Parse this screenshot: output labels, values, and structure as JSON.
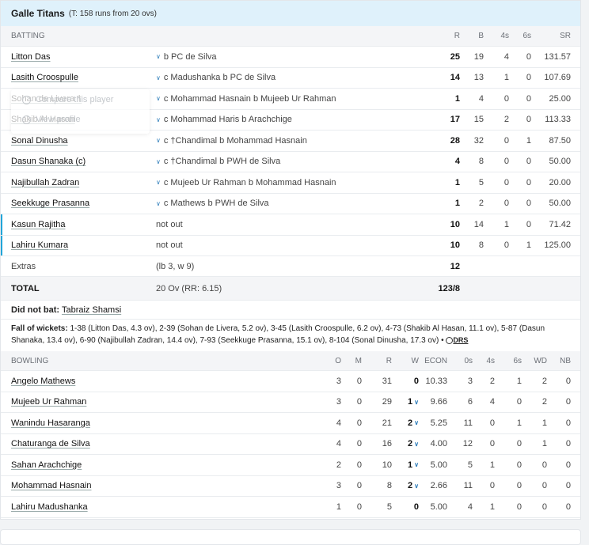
{
  "header": {
    "team": "Galle Titans",
    "target": "(T: 158 runs from 20 ovs)"
  },
  "batting": {
    "columns": {
      "label": "BATTING",
      "r": "R",
      "b": "B",
      "fours": "4s",
      "sixes": "6s",
      "sr": "SR"
    },
    "rows": [
      {
        "name": "Litton Das",
        "dismissal": "b PC de Silva",
        "r": "25",
        "b": "19",
        "fours": "4",
        "sixes": "0",
        "sr": "131.57",
        "not_out": false
      },
      {
        "name": "Lasith Croospulle",
        "dismissal": "c Madushanka b PC de Silva",
        "r": "14",
        "b": "13",
        "fours": "1",
        "sixes": "0",
        "sr": "107.69",
        "not_out": false
      },
      {
        "name": "Sohan de Livera †",
        "dismissal": "c Mohammad Hasnain b Mujeeb Ur Rahman",
        "r": "1",
        "b": "4",
        "fours": "0",
        "sixes": "0",
        "sr": "25.00",
        "not_out": false
      },
      {
        "name": "Shakib Al Hasan",
        "dismissal": "c Mohammad Haris b Arachchige",
        "r": "17",
        "b": "15",
        "fours": "2",
        "sixes": "0",
        "sr": "113.33",
        "not_out": false
      },
      {
        "name": "Sonal Dinusha",
        "dismissal": "c †Chandimal b Mohammad Hasnain",
        "r": "28",
        "b": "32",
        "fours": "0",
        "sixes": "1",
        "sr": "87.50",
        "not_out": false
      },
      {
        "name": "Dasun Shanaka (c)",
        "dismissal": "c †Chandimal b PWH de Silva",
        "r": "4",
        "b": "8",
        "fours": "0",
        "sixes": "0",
        "sr": "50.00",
        "not_out": false
      },
      {
        "name": "Najibullah Zadran",
        "dismissal": "c Mujeeb Ur Rahman b Mohammad Hasnain",
        "r": "1",
        "b": "5",
        "fours": "0",
        "sixes": "0",
        "sr": "20.00",
        "not_out": false
      },
      {
        "name": "Seekkuge Prasanna",
        "dismissal": "c Mathews b PWH de Silva",
        "r": "1",
        "b": "2",
        "fours": "0",
        "sixes": "0",
        "sr": "50.00",
        "not_out": false
      },
      {
        "name": "Kasun Rajitha",
        "dismissal": "not out",
        "r": "10",
        "b": "14",
        "fours": "1",
        "sixes": "0",
        "sr": "71.42",
        "not_out": true
      },
      {
        "name": "Lahiru Kumara",
        "dismissal": "not out",
        "r": "10",
        "b": "8",
        "fours": "0",
        "sixes": "1",
        "sr": "125.00",
        "not_out": true
      }
    ],
    "extras": {
      "label": "Extras",
      "detail": "(lb 3, w 9)",
      "value": "12"
    },
    "total": {
      "label": "TOTAL",
      "detail": "20 Ov (RR: 6.15)",
      "value": "123/8"
    }
  },
  "did_not_bat": {
    "label": "Did not bat:",
    "players": "Tabraiz Shamsi"
  },
  "fall_of_wickets": {
    "label": "Fall of wickets:",
    "text": "1-38 (Litton Das, 4.3 ov), 2-39 (Sohan de Livera, 5.2 ov), 3-45 (Lasith Croospulle, 6.2 ov), 4-73 (Shakib Al Hasan, 11.1 ov), 5-87 (Dasun Shanaka, 13.4 ov), 6-90 (Najibullah Zadran, 14.4 ov), 7-93 (Seekkuge Prasanna, 15.1 ov), 8-104 (Sonal Dinusha, 17.3 ov) •",
    "drs": "DRS"
  },
  "bowling": {
    "columns": {
      "label": "BOWLING",
      "o": "O",
      "m": "M",
      "r": "R",
      "w": "W",
      "econ": "ECON",
      "dots": "0s",
      "fours": "4s",
      "sixes": "6s",
      "wd": "WD",
      "nb": "NB"
    },
    "rows": [
      {
        "name": "Angelo Mathews",
        "o": "3",
        "m": "0",
        "r": "31",
        "w": "0",
        "econ": "10.33",
        "dots": "3",
        "fours": "2",
        "sixes": "1",
        "wd": "2",
        "nb": "0",
        "expand": false
      },
      {
        "name": "Mujeeb Ur Rahman",
        "o": "3",
        "m": "0",
        "r": "29",
        "w": "1",
        "econ": "9.66",
        "dots": "6",
        "fours": "4",
        "sixes": "0",
        "wd": "2",
        "nb": "0",
        "expand": true
      },
      {
        "name": "Wanindu Hasaranga",
        "o": "4",
        "m": "0",
        "r": "21",
        "w": "2",
        "econ": "5.25",
        "dots": "11",
        "fours": "0",
        "sixes": "1",
        "wd": "1",
        "nb": "0",
        "expand": true
      },
      {
        "name": "Chaturanga de Silva",
        "o": "4",
        "m": "0",
        "r": "16",
        "w": "2",
        "econ": "4.00",
        "dots": "12",
        "fours": "0",
        "sixes": "0",
        "wd": "1",
        "nb": "0",
        "expand": true
      },
      {
        "name": "Sahan Arachchige",
        "o": "2",
        "m": "0",
        "r": "10",
        "w": "1",
        "econ": "5.00",
        "dots": "5",
        "fours": "1",
        "sixes": "0",
        "wd": "0",
        "nb": "0",
        "expand": true
      },
      {
        "name": "Mohammad Hasnain",
        "o": "3",
        "m": "0",
        "r": "8",
        "w": "2",
        "econ": "2.66",
        "dots": "11",
        "fours": "0",
        "sixes": "0",
        "wd": "0",
        "nb": "0",
        "expand": true
      },
      {
        "name": "Lahiru Madushanka",
        "o": "1",
        "m": "0",
        "r": "5",
        "w": "0",
        "econ": "5.00",
        "dots": "4",
        "fours": "1",
        "sixes": "0",
        "wd": "0",
        "nb": "0",
        "expand": false
      }
    ]
  },
  "popup": {
    "compare": "Compare this player",
    "view_profile": "View profile"
  },
  "icons": {
    "dismissal_expand": "chevron-down-icon",
    "popup_compare": "compare-icon",
    "popup_profile": "profile-icon",
    "drs": "drs-icon"
  },
  "colors": {
    "header_bg": "#dff1fb",
    "not_out_accent": "#21a5d8",
    "link_accent": "#2b7bb9"
  }
}
